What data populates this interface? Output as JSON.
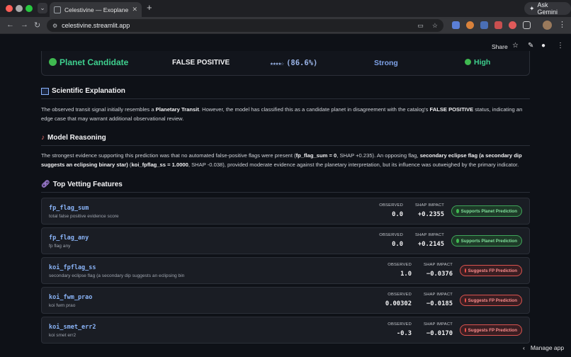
{
  "browser": {
    "tab_title": "Celestivine — Exoplanet Disc",
    "url": "celestivine.streamlit.app",
    "ask_gemini": "Ask Gemini"
  },
  "header": {
    "share": "Share"
  },
  "result": {
    "classification": "Planet Candidate",
    "catalog_label": "FALSE POSITIVE",
    "confidence": "(86.6%)",
    "confidence_stars": 4,
    "strength": "Strong",
    "priority": "High"
  },
  "explanation": {
    "title": "Scientific Explanation",
    "p1": "The observed transit signal initially resembles a ",
    "b1": "Planetary Transit",
    "p2": ". However, the model has classified this as a candidate planet in disagreement with the catalog's ",
    "b2": "FALSE POSITIVE",
    "p3": " status, indicating an edge case that may warrant additional observational review."
  },
  "reasoning": {
    "title": "Model Reasoning",
    "p1": "The strongest evidence supporting this prediction was that no automated false-positive flags were present (",
    "b1": "fp_flag_sum = 0",
    "p2": ", SHAP +0.235). An opposing flag, ",
    "b2": "secondary eclipse flag (a secondary dip suggests an eclipsing binary star)",
    "p3": " (",
    "b3": "koi_fpflag_ss = 1.0000",
    "p4": ", SHAP -0.038), provided moderate evidence against the planetary interpretation, but its influence was outweighed by the primary indicator."
  },
  "features": {
    "title": "Top Vetting Features",
    "observed_label": "OBSERVED",
    "shap_label": "SHAP IMPACT",
    "items": [
      {
        "name": "fp_flag_sum",
        "desc": "total false positive evidence score",
        "observed": "0.0",
        "shap": "+0.2355",
        "badge": "Supports Planet Prediction",
        "kind": "support"
      },
      {
        "name": "fp_flag_any",
        "desc": "fp flag any",
        "observed": "0.0",
        "shap": "+0.2145",
        "badge": "Supports Planet Prediction",
        "kind": "support"
      },
      {
        "name": "koi_fpflag_ss",
        "desc": "secondary eclipse flag (a secondary dip suggests an eclipsing bin",
        "observed": "1.0",
        "shap": "−0.0376",
        "badge": "Suggests FP Prediction",
        "kind": "fp"
      },
      {
        "name": "koi_fwm_prao",
        "desc": "koi fwm prao",
        "observed": "0.00302",
        "shap": "−0.0185",
        "badge": "Suggests FP Prediction",
        "kind": "fp"
      },
      {
        "name": "koi_smet_err2",
        "desc": "koi smet err2",
        "observed": "-0.3",
        "shap": "−0.0170",
        "badge": "Suggests FP Prediction",
        "kind": "fp"
      }
    ]
  },
  "footer": {
    "manage_app": "Manage app"
  },
  "colors": {
    "support": "#3fb950",
    "fp": "#f85149",
    "accent_blue": "#8ab4f8"
  }
}
